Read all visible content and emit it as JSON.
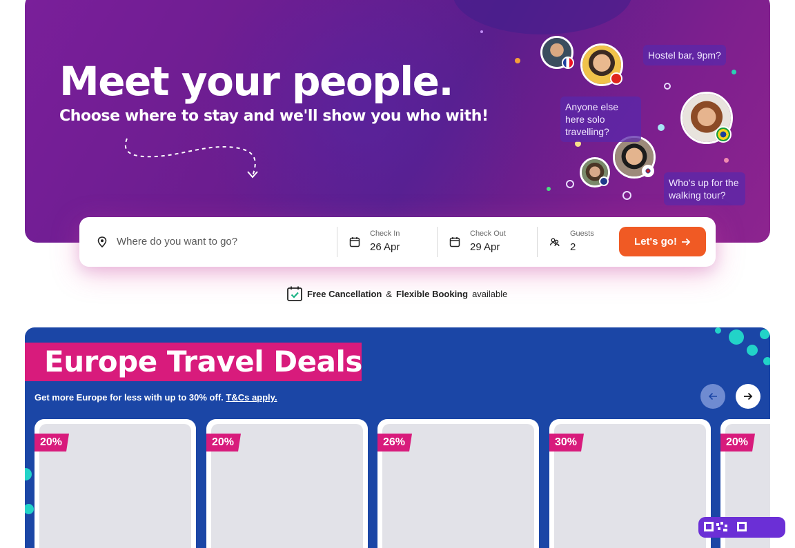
{
  "hero": {
    "title": "Meet your people.",
    "subtitle": "Choose where to stay and we'll show you who with!",
    "bubbles": [
      "Hostel bar, 9pm?",
      "Anyone else here solo travelling?",
      "Who's up for the walking tour?"
    ]
  },
  "search": {
    "placeholder": "Where do you want to go?",
    "check_in_label": "Check In",
    "check_in_value": "26 Apr",
    "check_out_label": "Check Out",
    "check_out_value": "29 Apr",
    "guests_label": "Guests",
    "guests_value": "2",
    "button_label": "Let's go!"
  },
  "notice": {
    "part1": "Free Cancellation",
    "amp": "&",
    "part2": "Flexible Booking",
    "part3": "available"
  },
  "deals": {
    "title": "Europe Travel Deals",
    "subtitle": "Get more Europe for less with up to 30% off.",
    "link": "T&Cs apply.",
    "cards": [
      {
        "discount": "20%"
      },
      {
        "discount": "20%"
      },
      {
        "discount": "26%"
      },
      {
        "discount": "30%"
      },
      {
        "discount": "20%"
      }
    ]
  },
  "colors": {
    "accent": "#f05a24",
    "pink": "#d81b7c",
    "deals_bg": "#1b46a6"
  }
}
